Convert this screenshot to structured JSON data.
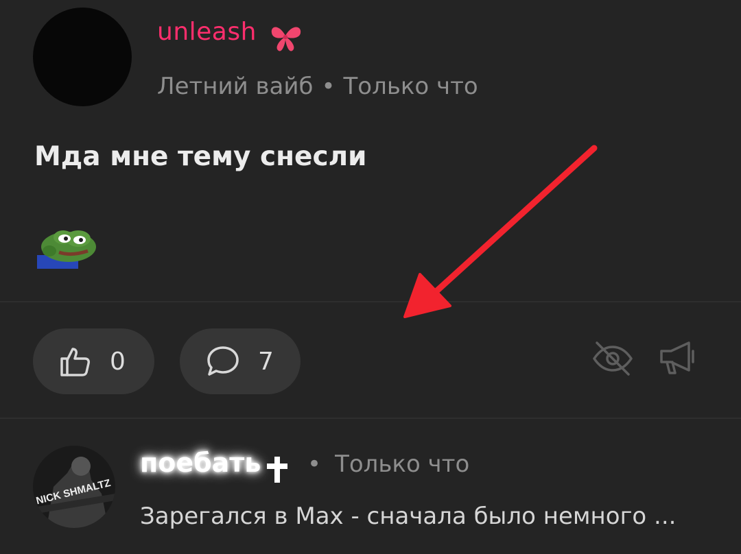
{
  "post": {
    "author": "unleash",
    "author_badge_icon": "butterfly-bow-icon",
    "community": "Летний вайб",
    "separator": "•",
    "time": "Только что",
    "text": "Мда мне тему снесли",
    "sticker": "pepe-frog-sticker"
  },
  "actions": {
    "like_count": "0",
    "comment_count": "7",
    "hide_icon": "eye-off-icon",
    "report_icon": "megaphone-icon"
  },
  "reply": {
    "author": "поебать",
    "author_badge_icon": "cross-icon",
    "separator": "•",
    "time": "Только что",
    "text": "Зарегался в Max - сначала было немного ...",
    "avatar_text": "NICK SHMALTZ"
  },
  "colors": {
    "background": "#242424",
    "username": "#ff2e6d",
    "pill": "#363636",
    "annotation_arrow": "#f2232e"
  }
}
